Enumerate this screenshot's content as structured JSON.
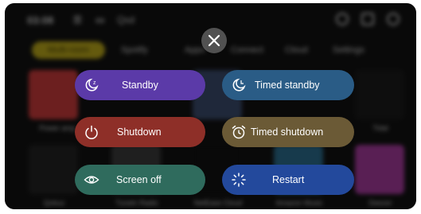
{
  "status_bar": {
    "time": "03:08",
    "extra": "Qsd"
  },
  "tabs": [
    "Multi-room",
    "Spotify",
    "Apps",
    "Connect",
    "Cloud",
    "Settings"
  ],
  "apps": [
    "Tidal",
    "Qobuz",
    "Tuneln Radio",
    "NetEase Cloud",
    "Amazon Music",
    "Deezer"
  ],
  "power_menu": {
    "close_label": "Close",
    "buttons": [
      {
        "id": "standby",
        "label": "Standby",
        "color": "#5b3aa8",
        "icon": "standby-icon"
      },
      {
        "id": "timed-standby",
        "label": "Timed standby",
        "color": "#2a5c86",
        "icon": "timed-standby-icon"
      },
      {
        "id": "shutdown",
        "label": "Shutdown",
        "color": "#8e2f28",
        "icon": "power-icon"
      },
      {
        "id": "timed-shutdown",
        "label": "Timed shutdown",
        "color": "#6b5a36",
        "icon": "alarm-clock-icon"
      },
      {
        "id": "screen-off",
        "label": "Screen off",
        "color": "#2f6b5d",
        "icon": "eye-icon"
      },
      {
        "id": "restart",
        "label": "Restart",
        "color": "#23499c",
        "icon": "restart-icon"
      }
    ]
  }
}
